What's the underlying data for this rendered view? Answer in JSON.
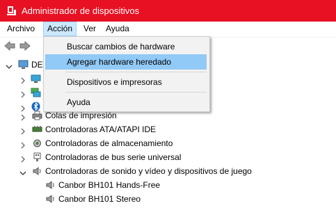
{
  "window": {
    "title": "Administrador de dispositivos"
  },
  "menubar": [
    "Archivo",
    "Acción",
    "Ver",
    "Ayuda"
  ],
  "dropdown": {
    "items": [
      "Buscar cambios de hardware",
      "Agregar hardware heredado",
      "Dispositivos e impresoras",
      "Ayuda"
    ],
    "highlighted": "Agregar hardware heredado"
  },
  "tree": {
    "root_label_visible": "DE",
    "items": [
      "Colas de impresión",
      "Controladoras ATA/ATAPI IDE",
      "Controladoras de almacenamiento",
      "Controladoras de bus serie universal",
      "Controladoras de sonido y vídeo y dispositivos de juego",
      "Canbor BH101 Hands-Free",
      "Canbor BH101 Stereo"
    ]
  },
  "colors": {
    "titlebar": "#e81123",
    "menu_active": "#cce8ff",
    "dropdown_highlight": "#91c9f7",
    "dropdown_bg": "#f2f2f2"
  }
}
